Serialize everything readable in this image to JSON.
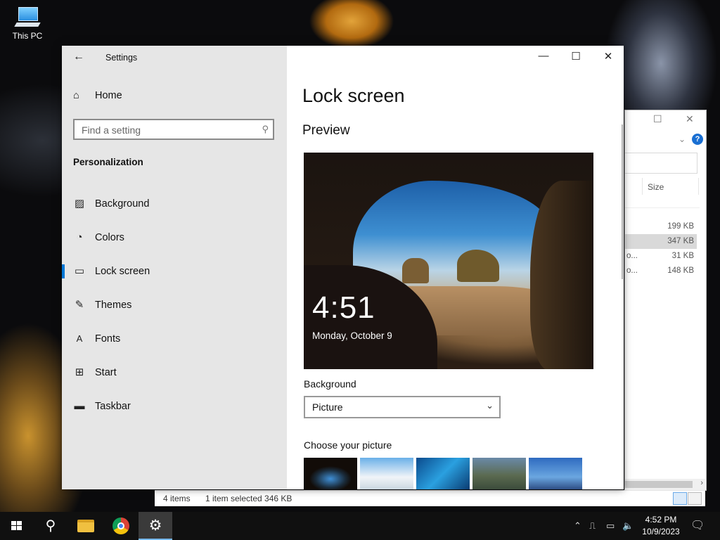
{
  "desktop": {
    "icon_label": "This PC"
  },
  "explorer": {
    "size_header": "Size",
    "rows": [
      {
        "name": "",
        "size": "199 KB"
      },
      {
        "name": "",
        "size": "347 KB"
      },
      {
        "name": "o...",
        "size": "31 KB"
      },
      {
        "name": "o...",
        "size": "148 KB"
      }
    ],
    "status": {
      "items": "4 items",
      "selected": "1 item selected  346 KB"
    }
  },
  "settings": {
    "app_title": "Settings",
    "home_label": "Home",
    "search_placeholder": "Find a setting",
    "section_title": "Personalization",
    "nav": [
      {
        "label": "Background",
        "icon": "image-icon"
      },
      {
        "label": "Colors",
        "icon": "palette-icon"
      },
      {
        "label": "Lock screen",
        "icon": "lock-screen-icon",
        "selected": true
      },
      {
        "label": "Themes",
        "icon": "brush-icon"
      },
      {
        "label": "Fonts",
        "icon": "font-icon"
      },
      {
        "label": "Start",
        "icon": "start-icon"
      },
      {
        "label": "Taskbar",
        "icon": "taskbar-icon"
      }
    ],
    "page_title": "Lock screen",
    "preview_title": "Preview",
    "preview_time": "4:51",
    "preview_date": "Monday, October 9",
    "background_label": "Background",
    "background_value": "Picture",
    "choose_label": "Choose your picture"
  },
  "taskbar": {
    "time": "4:52 PM",
    "date": "10/9/2023"
  },
  "colors": {
    "accent": "#0078d7",
    "sidebar": "#e6e6e6",
    "taskbar": "#101010"
  }
}
